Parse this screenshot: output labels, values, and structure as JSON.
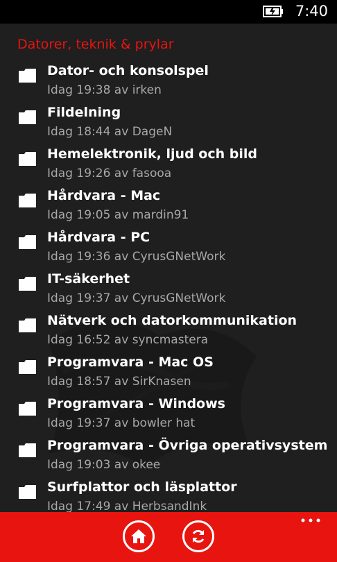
{
  "status": {
    "time": "7:40",
    "battery_icon": "battery-charging-icon"
  },
  "section": {
    "title": "Datorer, teknik & prylar"
  },
  "forums": [
    {
      "name": "Dator- och konsolspel",
      "meta": "Idag 19:38 av irken"
    },
    {
      "name": "Fildelning",
      "meta": "Idag 18:44 av DageN"
    },
    {
      "name": "Hemelektronik, ljud och bild",
      "meta": "Idag 19:26 av fasooa"
    },
    {
      "name": "Hårdvara - Mac",
      "meta": "Idag 19:05 av mardin91"
    },
    {
      "name": "Hårdvara - PC",
      "meta": "Idag 19:36 av CyrusGNetWork"
    },
    {
      "name": "IT-säkerhet",
      "meta": "Idag 19:37 av CyrusGNetWork"
    },
    {
      "name": "Nätverk och datorkommunikation",
      "meta": "Idag 16:52 av syncmastera"
    },
    {
      "name": "Programvara - Mac OS",
      "meta": "Idag 18:57 av SirKnasen"
    },
    {
      "name": "Programvara - Windows",
      "meta": "Idag 19:37 av bowler hat"
    },
    {
      "name": "Programvara - Övriga operativsystem",
      "meta": "Idag 19:03 av okee"
    },
    {
      "name": "Surfplattor och läsplattor",
      "meta": "Idag 17:49 av HerbsandInk"
    }
  ],
  "app_bar": {
    "buttons": [
      "home-icon",
      "refresh-icon"
    ],
    "more": "ellipsis-icon"
  },
  "colors": {
    "accent": "#e8140f",
    "background": "#1f1f1f",
    "meta_text": "#a8a8a8"
  }
}
